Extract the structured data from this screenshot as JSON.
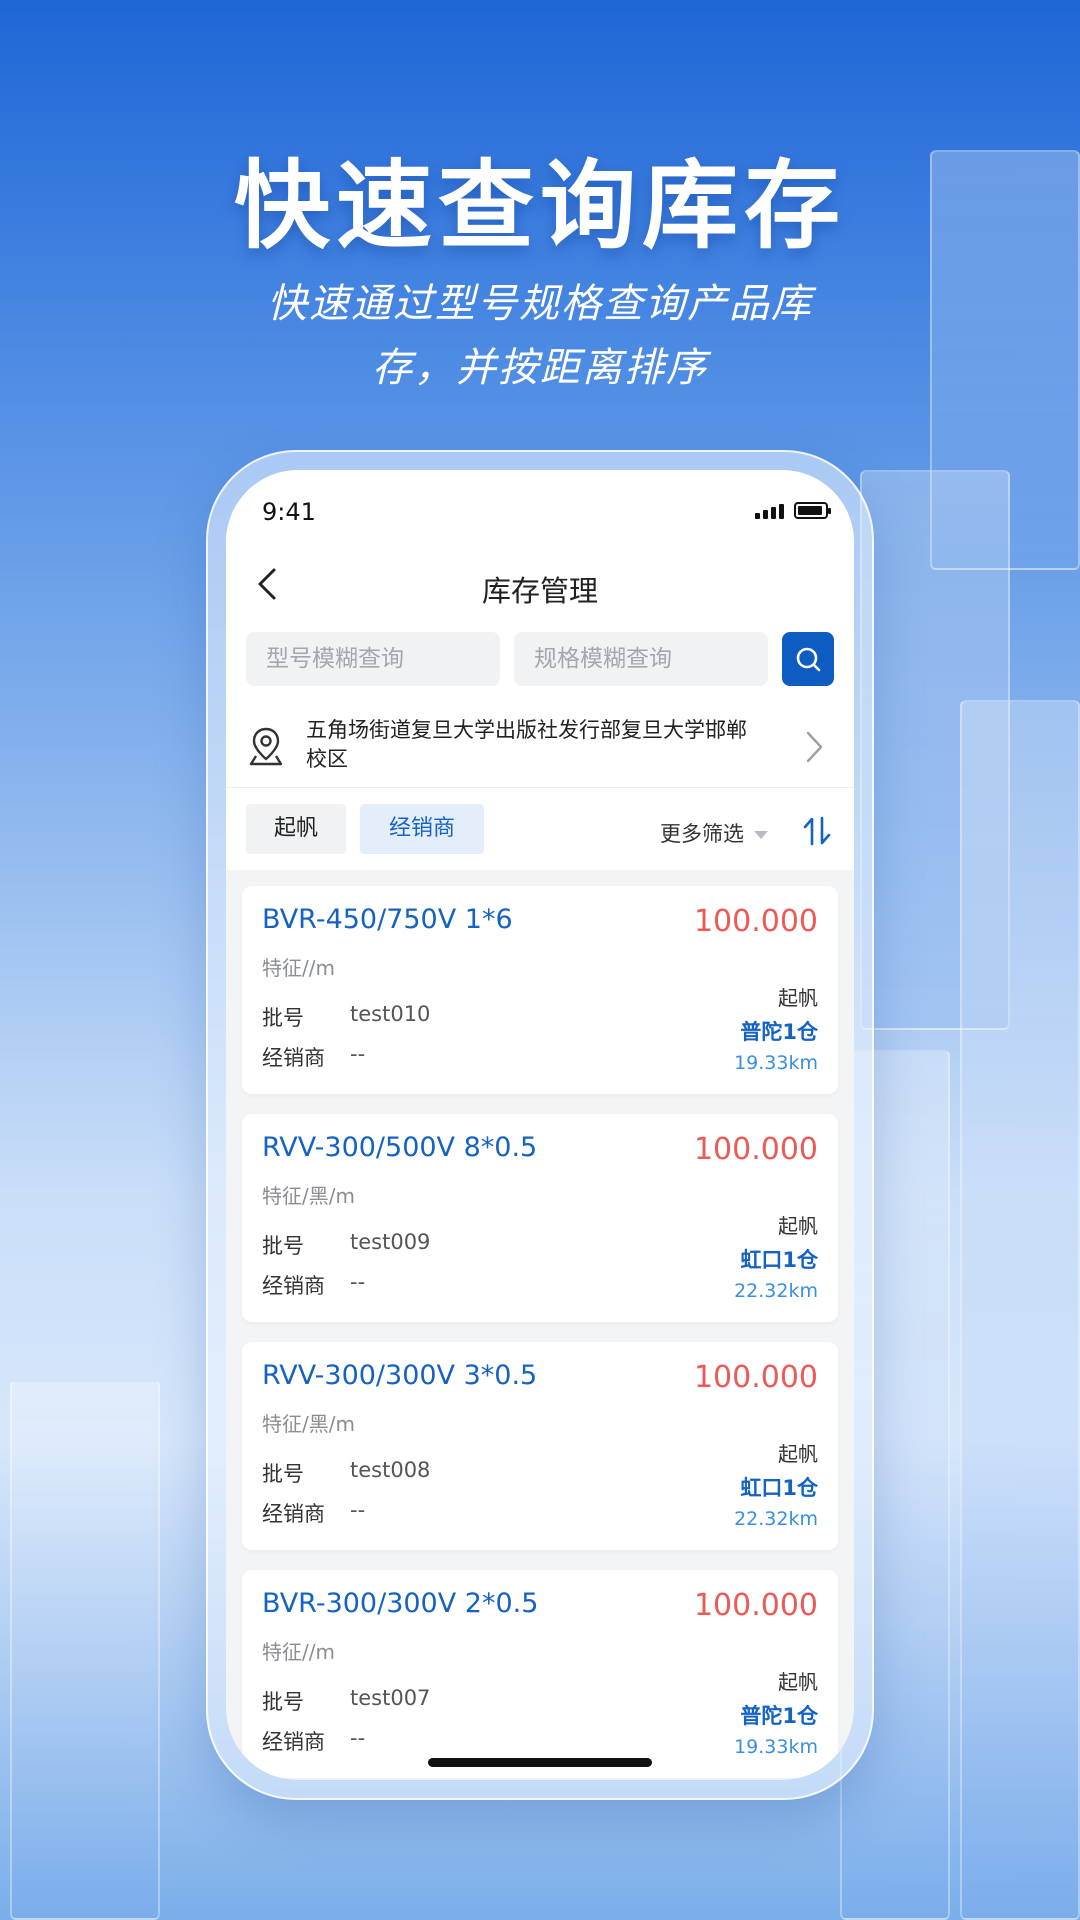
{
  "promo": {
    "headline": "快速查询库存",
    "subline": "快速通过型号规格查询产品库存，并按距离排序"
  },
  "status_bar": {
    "time": "9:41"
  },
  "nav": {
    "title": "库存管理"
  },
  "search": {
    "model_placeholder": "型号模糊查询",
    "spec_placeholder": "规格模糊查询"
  },
  "address": {
    "text": "五角场街道复旦大学出版社发行部复旦大学邯郸校区"
  },
  "filters": {
    "chips": [
      {
        "label": "起帆",
        "active": false
      },
      {
        "label": "经销商",
        "active": true
      }
    ],
    "more_label": "更多筛选"
  },
  "colors": {
    "primary": "#0c5cc2",
    "quantity": "#ec5a55",
    "distance": "#3a8fe0"
  },
  "items": [
    {
      "model": "BVR-450/750V 1*6",
      "quantity": "100.000",
      "feature": "特征//m",
      "batch_label": "批号",
      "batch": "test010",
      "dealer_label": "经销商",
      "dealer": "--",
      "brand": "起帆",
      "warehouse": "普陀1仓",
      "distance": "19.33km"
    },
    {
      "model": "RVV-300/500V 8*0.5",
      "quantity": "100.000",
      "feature": "特征/黑/m",
      "batch_label": "批号",
      "batch": "test009",
      "dealer_label": "经销商",
      "dealer": "--",
      "brand": "起帆",
      "warehouse": "虹口1仓",
      "distance": "22.32km"
    },
    {
      "model": "RVV-300/300V 3*0.5",
      "quantity": "100.000",
      "feature": "特征/黑/m",
      "batch_label": "批号",
      "batch": "test008",
      "dealer_label": "经销商",
      "dealer": "--",
      "brand": "起帆",
      "warehouse": "虹口1仓",
      "distance": "22.32km"
    },
    {
      "model": "BVR-300/300V 2*0.5",
      "quantity": "100.000",
      "feature": "特征//m",
      "batch_label": "批号",
      "batch": "test007",
      "dealer_label": "经销商",
      "dealer": "--",
      "brand": "起帆",
      "warehouse": "普陀1仓",
      "distance": "19.33km"
    }
  ]
}
